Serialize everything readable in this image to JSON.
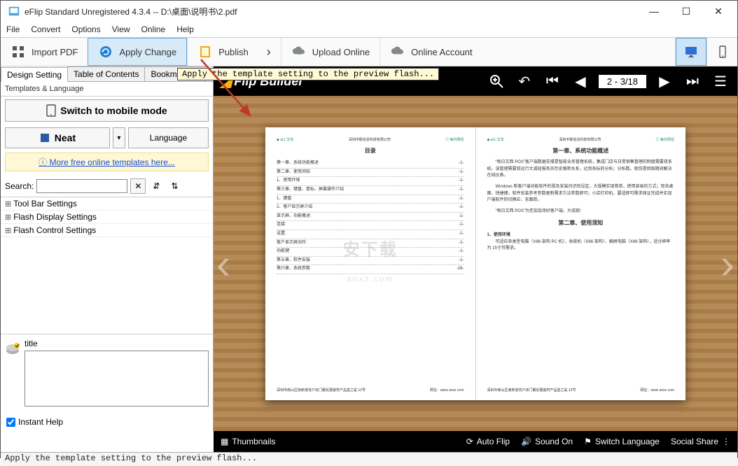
{
  "title": "eFlip Standard Unregistered 4.3.4  -- D:\\桌面\\说明书\\2.pdf",
  "menu": [
    "File",
    "Convert",
    "Options",
    "View",
    "Online",
    "Help"
  ],
  "toolbar": {
    "import": "Import PDF",
    "apply": "Apply Change",
    "publish": "Publish",
    "upload": "Upload Online",
    "account": "Online Account"
  },
  "tooltip": "Apply the template setting to the preview flash...",
  "tabs": [
    "Design Setting",
    "Table of Contents",
    "Bookmark Ta"
  ],
  "side": {
    "group": "Templates & Language",
    "switch": "Switch to mobile mode",
    "neat": "Neat",
    "language": "Language",
    "link": "More free online templates here...",
    "search": "Search:",
    "tree": [
      "Tool Bar Settings",
      "Flash Display Settings",
      "Flash Control Settings"
    ],
    "prop": "title",
    "instant": "Instant Help"
  },
  "preview": {
    "logo": "Flip Builder",
    "page": "2 - 3/18",
    "thumbs": "Thumbnails",
    "autoflip": "Auto Flip",
    "sound": "Sound On",
    "switchlang": "Switch Language",
    "share": "Social Share"
  },
  "book": {
    "left": {
      "heading": "目录",
      "items": [
        [
          "第一章、系统功能概述",
          "-1-"
        ],
        [
          "第二章、使用须知",
          "-1-"
        ],
        [
          "1、使用环境",
          "-1-"
        ],
        [
          "第三章、键盘、鼠标、屏幕操作介绍",
          "-1-"
        ],
        [
          "1、键盘",
          "-1-"
        ],
        [
          "2、客户显示屏介绍",
          "-1-"
        ],
        [
          "显示屏、功能概述:",
          "-1-"
        ],
        [
          "连接:",
          "-1-"
        ],
        [
          "设置:",
          "-1-"
        ],
        [
          "客户显示屏动作:",
          "-1-"
        ],
        [
          "功能键:",
          "-1-"
        ],
        [
          "第五章、软件安装",
          "-1-"
        ],
        [
          "第六章、系统参数",
          "-16-"
        ]
      ]
    },
    "right": {
      "h1": "第一章、系统功能概述",
      "p1": "“每日文西 POS”客户端数据支撑是智能业务管理系统，集成门店与日常销售管理的制度需要双系统。该管理需要双运行大减轻报务员历史缩密水系，达到各标的分析；分析数。就你提供极期间解决在线仪表。",
      "p2": "Windows 新客户端功能软件的规及安装问识别设定，大规模实现简单，使用容易的方式；双击桌面、快捷键，软件安装参考参数更新需求方法参数即可；小店打印机、要适即可需求保证完成并实现户端软件的切换应、无跟踪。",
      "p3": "“每日文西 POS”为您加加添好客户端，大成就!",
      "h2": "第二章、使用须知",
      "sub": "1、使用环境",
      "p4": "可适应各类型电脑（X86 架构 PC 机）、收款机（X86 架构）、触屏电脑（X86 架构），适分辨率为 15寸可需求。"
    },
    "footerL": "深圳市南山区南新塔背户双门翼反展装符产品盒之是 12号",
    "footerR": "网址：www anxz com"
  },
  "status": "Apply the template setting to the preview flash..."
}
